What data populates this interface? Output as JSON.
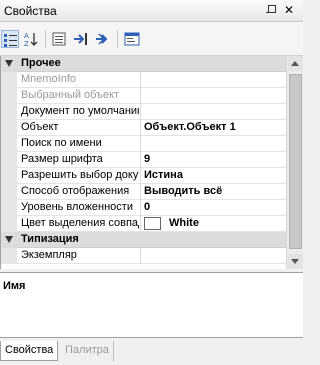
{
  "panel": {
    "title": "Свойства",
    "close_glyph": "✕"
  },
  "toolbar": {
    "buttons": [
      {
        "name": "categorized-view-icon",
        "selected": true
      },
      {
        "name": "sort-alphabetical-icon",
        "selected": false
      },
      {
        "name": "property-pages-icon",
        "selected": false
      },
      {
        "name": "go-to-selected-icon",
        "selected": false
      },
      {
        "name": "go-to-next-icon",
        "selected": false
      },
      {
        "name": "form-view-icon",
        "selected": false
      }
    ]
  },
  "categories": [
    {
      "label": "Прочее",
      "rows": [
        {
          "name": "MnemoInfo",
          "value": "",
          "disabled": true
        },
        {
          "name": "Выбранный объект",
          "value": "",
          "disabled": true
        },
        {
          "name": "Документ по умолчанию",
          "value": "",
          "disabled": false
        },
        {
          "name": "Объект",
          "value": "Объект.Объект 1",
          "disabled": false
        },
        {
          "name": "Поиск по имени",
          "value": "",
          "disabled": false
        },
        {
          "name": "Размер шрифта",
          "value": "9",
          "disabled": false
        },
        {
          "name": "Разрешить выбор документа",
          "value": "Истина",
          "disabled": false
        },
        {
          "name": "Способ отображения",
          "value": "Выводить всё",
          "disabled": false
        },
        {
          "name": "Уровень вложенности",
          "value": "0",
          "disabled": false
        },
        {
          "name": "Цвет выделения совпадений",
          "value": "White",
          "disabled": false,
          "swatch": "#ffffff"
        }
      ]
    },
    {
      "label": "Типизация",
      "rows": [
        {
          "name": "Экземпляр",
          "value": "",
          "disabled": false
        }
      ]
    }
  ],
  "description": {
    "title": "Имя"
  },
  "tabs": [
    {
      "label": "Свойства",
      "active": true
    },
    {
      "label": "Палитра",
      "active": false
    }
  ]
}
